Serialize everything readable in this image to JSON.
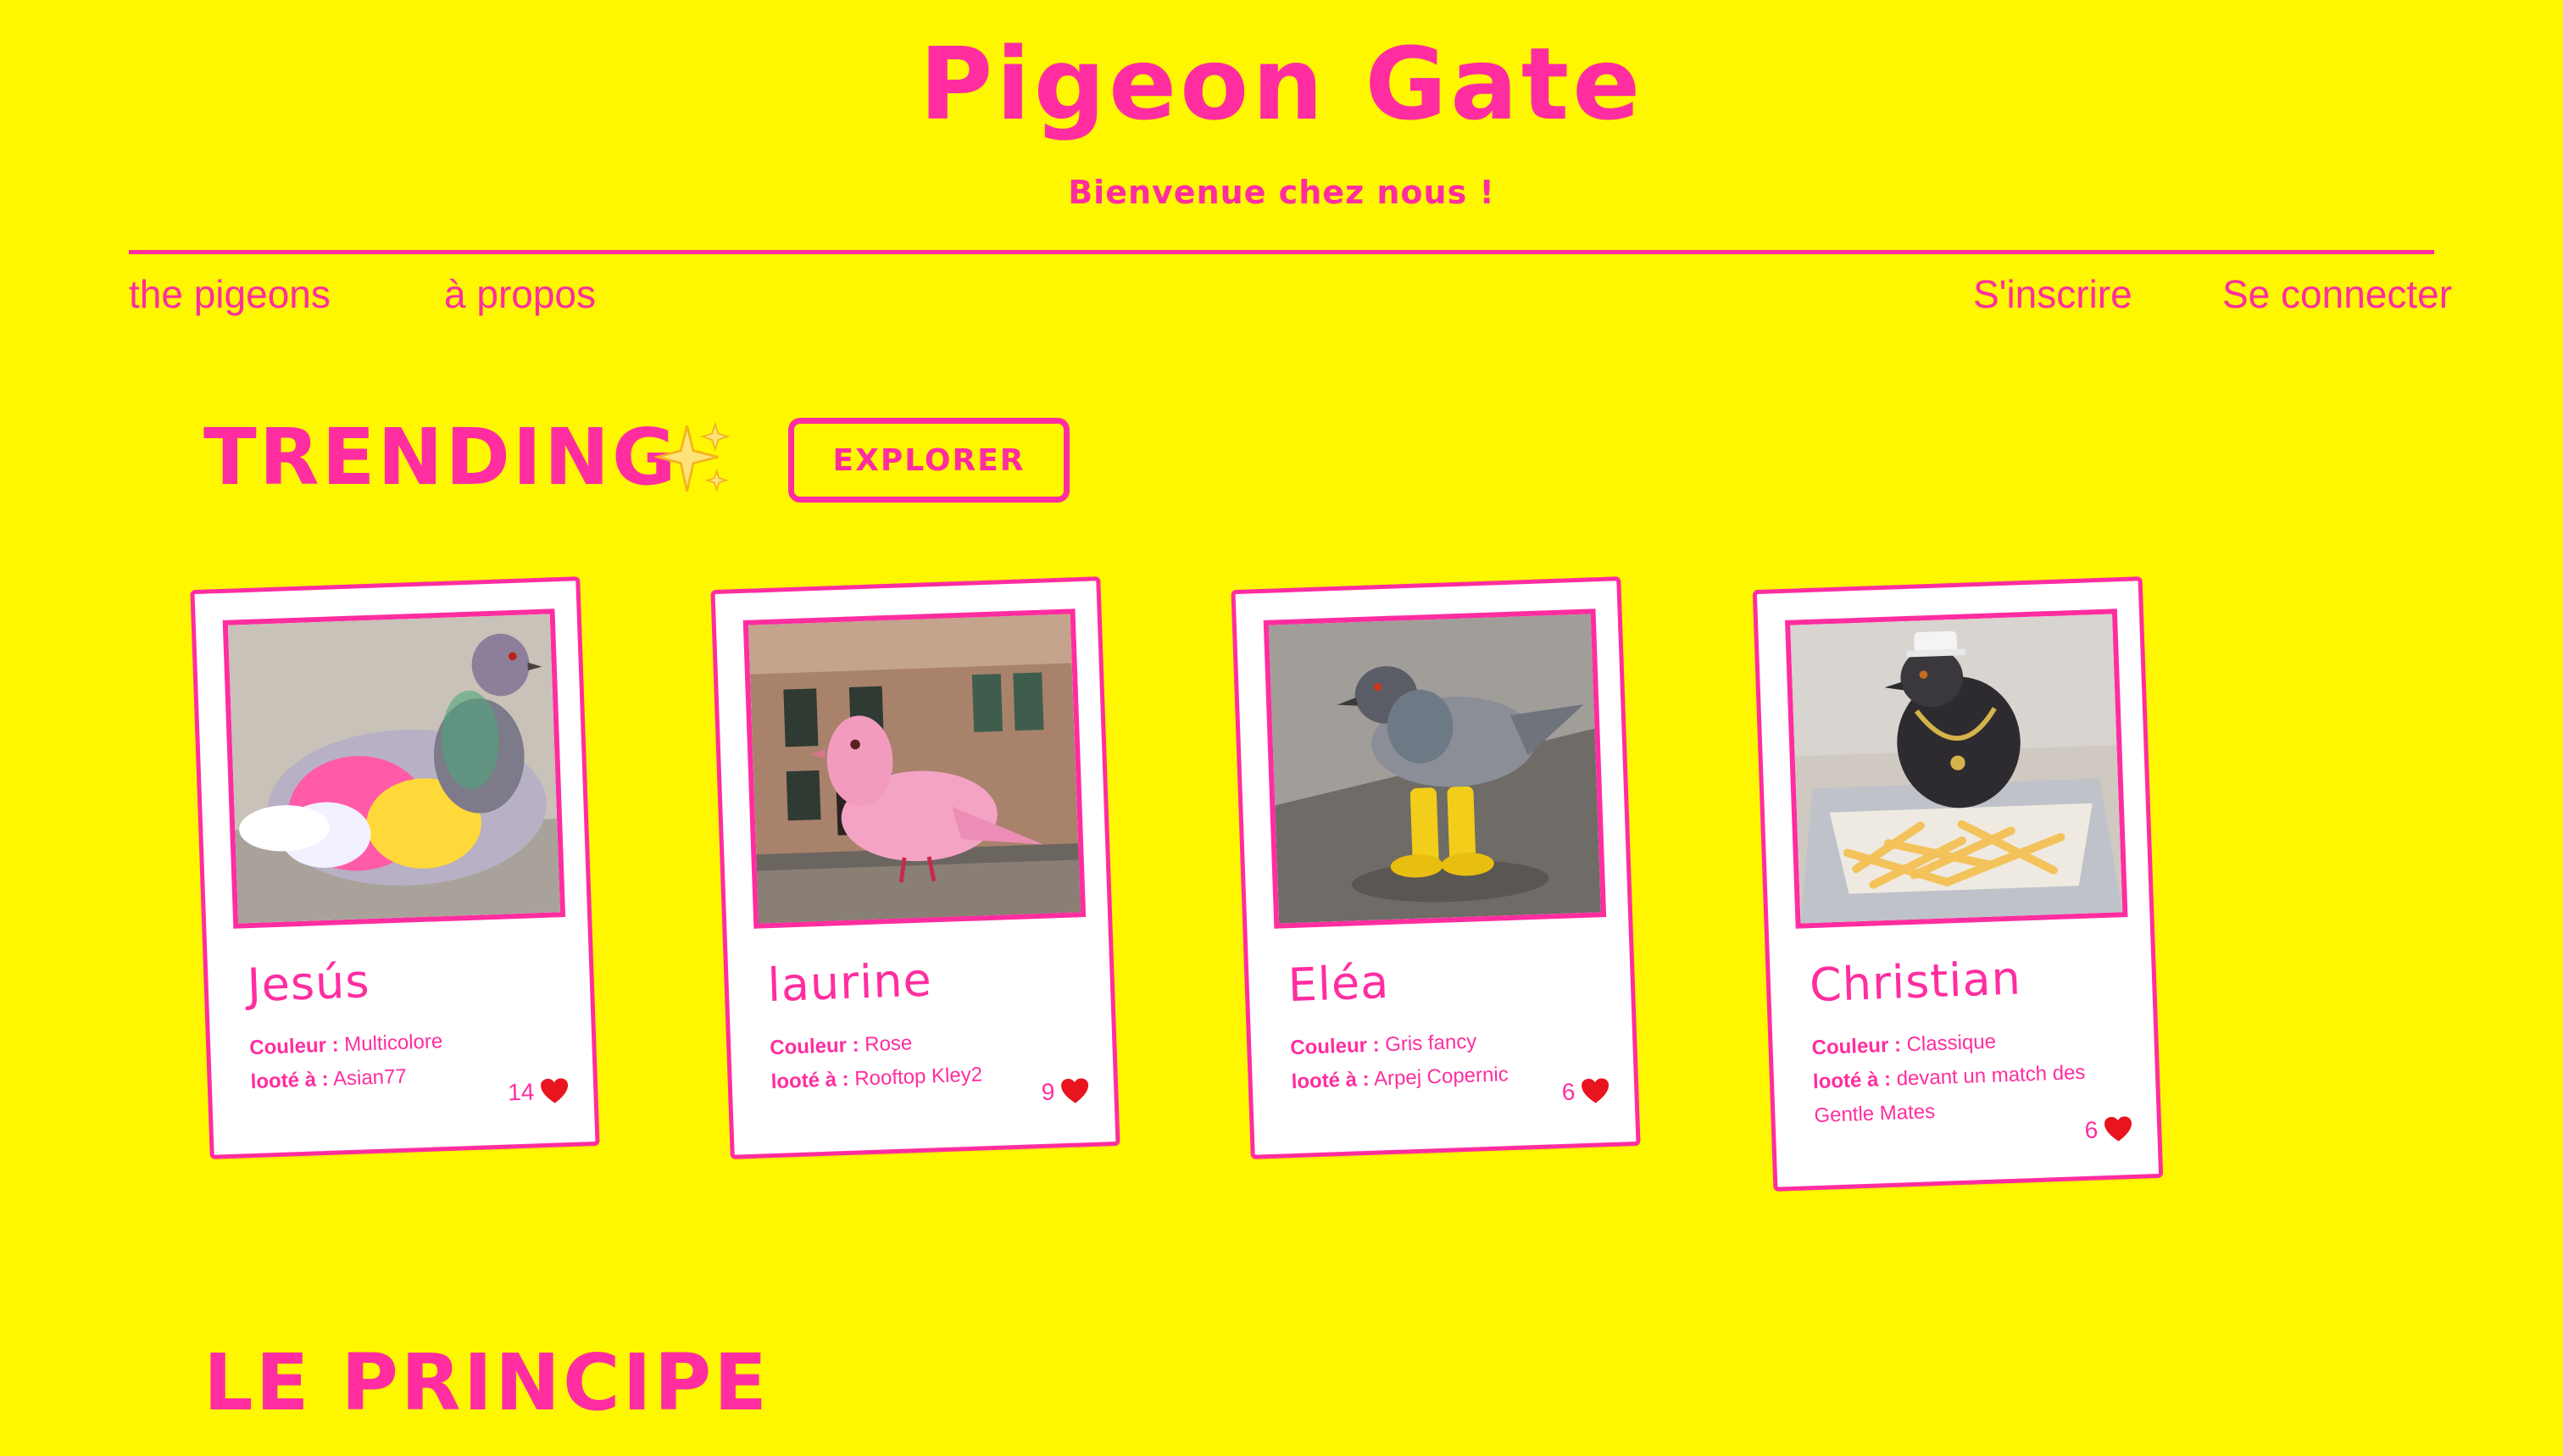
{
  "header": {
    "title": "Pigeon Gate",
    "tagline": "Bienvenue chez nous !"
  },
  "nav": {
    "left": [
      {
        "label": "the pigeons"
      },
      {
        "label": "à propos"
      }
    ],
    "right": [
      {
        "label": "S'inscrire"
      },
      {
        "label": "Se connecter"
      }
    ]
  },
  "trending": {
    "heading": "TRENDING",
    "sparkle_icon": "sparkles-icon",
    "explore_label": "EXPLORER"
  },
  "cards": [
    {
      "name": "Jesús",
      "color_key": "Couleur :",
      "color_value": "Multicolore",
      "loot_key": "looté à :",
      "loot_value": "Asian77",
      "likes": "14",
      "photo": "rainbow-dyed pigeon"
    },
    {
      "name": "laurine",
      "color_key": "Couleur :",
      "color_value": "Rose",
      "loot_key": "looté à :",
      "loot_value": "Rooftop Kley2",
      "likes": "9",
      "photo": "pink pigeon on a ledge"
    },
    {
      "name": "Eléa",
      "color_key": "Couleur :",
      "color_value": "Gris fancy",
      "loot_key": "looté à :",
      "loot_value": "Arpej Copernic",
      "likes": "6",
      "photo": "grey pigeon wearing yellow boots"
    },
    {
      "name": "Christian",
      "color_key": "Couleur :",
      "color_value": "Classique",
      "loot_key": "looté à :",
      "loot_value": "devant un match des Gentle Mates",
      "likes": "6",
      "photo": "pigeon with cap and chain on fries"
    }
  ],
  "principle": {
    "heading": "LE PRINCIPE"
  },
  "colors": {
    "background": "#fff700",
    "accent": "#ff2da0",
    "card": "#ffffff",
    "heart": "#e8141e"
  }
}
